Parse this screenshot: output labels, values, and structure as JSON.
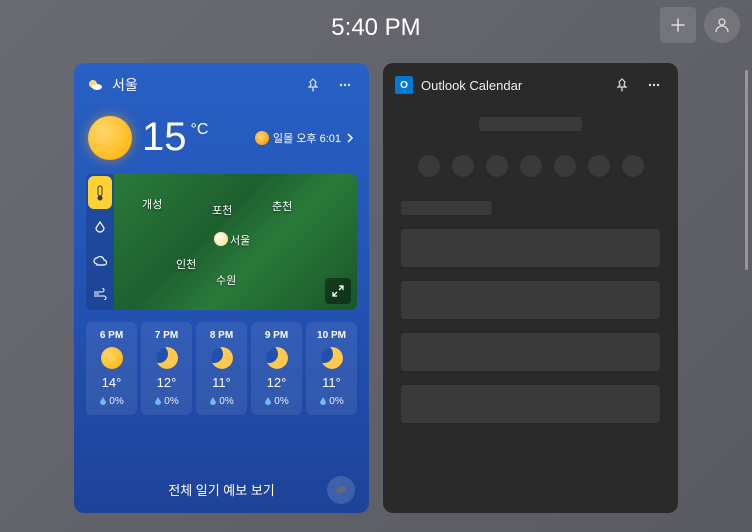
{
  "clock": "5:40 PM",
  "weather": {
    "location": "서울",
    "temp_value": "15",
    "temp_unit": "°C",
    "sunset_label": "일몰 오후 6:01",
    "map_cities": {
      "gaeseong": "개성",
      "pocheon": "포천",
      "chuncheon": "춘천",
      "seoul": "서울",
      "incheon": "인천",
      "suwon": "수원"
    },
    "hourly": [
      {
        "time": "6 PM",
        "icon": "sun",
        "temp": "14°",
        "precip": "0%"
      },
      {
        "time": "7 PM",
        "icon": "moon",
        "temp": "12°",
        "precip": "0%"
      },
      {
        "time": "8 PM",
        "icon": "moon",
        "temp": "11°",
        "precip": "0%"
      },
      {
        "time": "9 PM",
        "icon": "moon",
        "temp": "12°",
        "precip": "0%"
      },
      {
        "time": "10 PM",
        "icon": "moon",
        "temp": "11°",
        "precip": "0%"
      }
    ],
    "footer_link": "전체 일기 예보 보기"
  },
  "outlook": {
    "title": "Outlook Calendar"
  }
}
